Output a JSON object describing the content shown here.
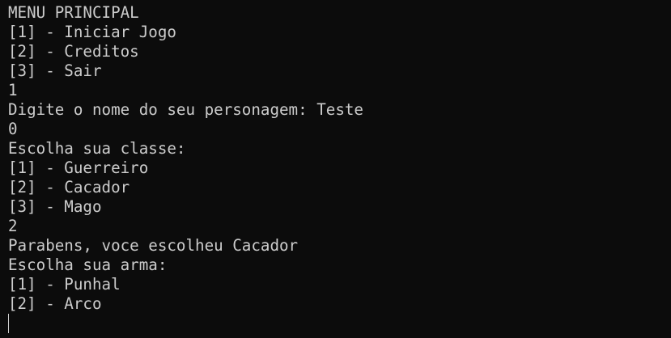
{
  "terminal": {
    "top_partial_line": "                         ",
    "lines": [
      "MENU PRINCIPAL",
      "[1] - Iniciar Jogo",
      "[2] - Creditos",
      "[3] - Sair",
      "1",
      "Digite o nome do seu personagem: Teste",
      "0",
      "Escolha sua classe:",
      "[1] - Guerreiro",
      "[2] - Cacador",
      "[3] - Mago",
      "2",
      "Parabens, voce escolheu Cacador",
      "Escolha sua arma:",
      "[1] - Punhal",
      "[2] - Arco"
    ],
    "colors": {
      "background": "#0c0c0c",
      "foreground": "#cccccc"
    }
  }
}
